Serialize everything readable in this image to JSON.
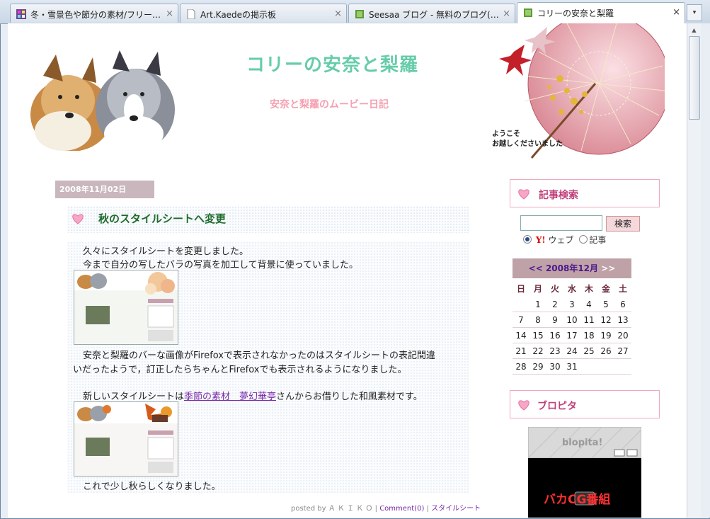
{
  "browser": {
    "tabs": [
      {
        "label": "冬・雪景色や節分の素材/フリー…",
        "icon": "site-favicon-grid",
        "active": false
      },
      {
        "label": "Art.Kaedeの掲示板",
        "icon": "page-icon",
        "active": false
      },
      {
        "label": "Seesaa ブログ - 無料のブログ(…",
        "icon": "book-icon",
        "active": false
      },
      {
        "label": "コリーの安奈と梨羅",
        "icon": "book-icon",
        "active": true
      }
    ],
    "close_glyph": "×",
    "tab_menu_glyph": "▾"
  },
  "header": {
    "title": "コリーの安奈と梨羅",
    "subtitle": "安奈と梨羅のムービー日記",
    "welcome_line1": "ようこそ",
    "welcome_line2": "お越しくださいました"
  },
  "post": {
    "date": "2008年11月02日",
    "title": "秋のスタイルシートへ変更",
    "p1": "久々にスタイルシートを変更しました。",
    "p2": "今まで自分の写したバラの写真を加工して背景に使っていました。",
    "p3a": "安奈と梨羅のバーな画像がFirefoxで表示されなかったのはスタイルシートの表記間違",
    "p3b": "いだったようで，訂正したらちゃんとFirefoxでも表示されるようになりました。",
    "p4_before": "新しいスタイルシートは",
    "p4_link": "季節の素材　夢幻華亭",
    "p4_after": "さんからお借りした和風素材です。",
    "p5": "これで少し秋らしくなりました。",
    "footer_posted": "posted by Ａ Ｋ Ｉ Ｋ Ｏ",
    "footer_comment": "Comment(0)",
    "footer_category": "スタイルシート",
    "footer_sep": "|"
  },
  "sidebar": {
    "search_title": "記事検索",
    "search_button": "検索",
    "search_value": "",
    "radio_web": "ウェブ",
    "radio_article": "記事",
    "yahoo_logo": "Y!",
    "calendar": {
      "prev": "<<",
      "month": "2008年12月",
      "next": ">>",
      "weekdays": [
        "日",
        "月",
        "火",
        "水",
        "木",
        "金",
        "土"
      ],
      "weeks": [
        [
          "",
          "1",
          "2",
          "3",
          "4",
          "5",
          "6"
        ],
        [
          "7",
          "8",
          "9",
          "10",
          "11",
          "12",
          "13"
        ],
        [
          "14",
          "15",
          "16",
          "17",
          "18",
          "19",
          "20"
        ],
        [
          "21",
          "22",
          "23",
          "24",
          "25",
          "26",
          "27"
        ],
        [
          "28",
          "29",
          "30",
          "31",
          "",
          "",
          ""
        ]
      ]
    },
    "blopita_title": "ブロピタ",
    "blopita_logo": "blopita!",
    "blopita_video_text": "バカCG番組"
  },
  "colors": {
    "title_green": "#66ccaa",
    "subtitle_pink": "#f5a0b0",
    "post_title_green": "#1f6b2c",
    "date_bg": "#c9b7bd",
    "link_purple": "#7a2aa8",
    "sidebar_title": "#c0407a"
  }
}
